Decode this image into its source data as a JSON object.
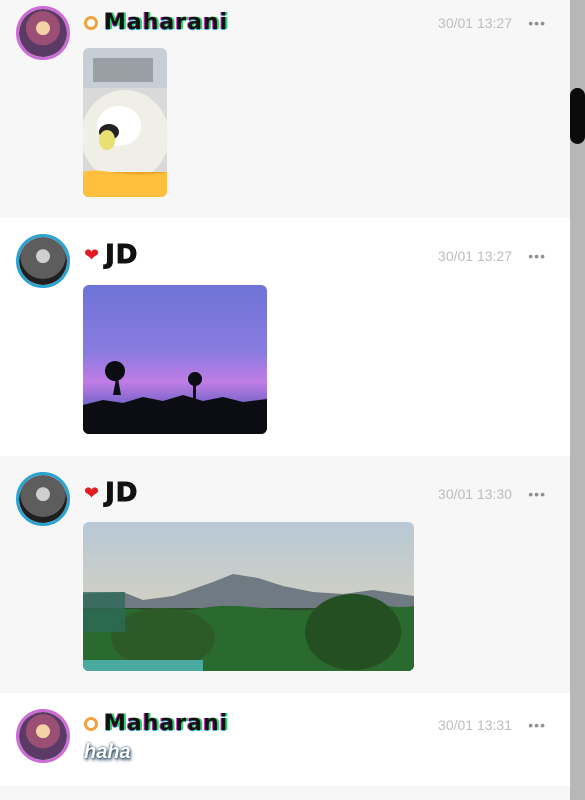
{
  "posts": [
    {
      "author": "Maharani",
      "timestamp": "30/01 13:27",
      "avatar_icon": "maharani-avatar-icon",
      "badge_icon": "orange-ring-badge-icon",
      "content_type": "image",
      "image_alt": "fluffy white dog"
    },
    {
      "author": "JD",
      "timestamp": "30/01 13:27",
      "avatar_icon": "jd-avatar-icon",
      "badge_icon": "heart-icon",
      "content_type": "image",
      "image_alt": "purple sunset sky"
    },
    {
      "author": "JD",
      "timestamp": "30/01 13:30",
      "avatar_icon": "jd-avatar-icon",
      "badge_icon": "heart-icon",
      "content_type": "image",
      "image_alt": "hills and greenery"
    },
    {
      "author": "Maharani",
      "timestamp": "30/01 13:31",
      "avatar_icon": "maharani-avatar-icon",
      "badge_icon": "orange-ring-badge-icon",
      "content_type": "text",
      "text": "haha"
    }
  ],
  "ui": {
    "more_glyph": "•••"
  },
  "colors": {
    "accent_pink": "#cc6bd6",
    "accent_blue": "#2aa3d2",
    "heart_red": "#e31b23",
    "timestamp_gray": "#bdbdbd"
  }
}
